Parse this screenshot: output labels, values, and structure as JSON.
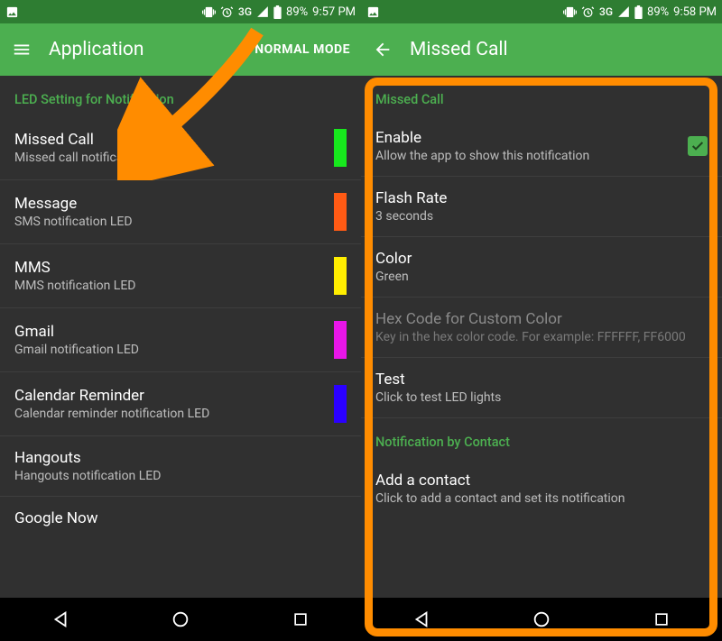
{
  "left": {
    "status": {
      "network": "3G",
      "battery": "89%",
      "time": "9:57 PM"
    },
    "appbar": {
      "title": "Application",
      "mode": "NORMAL MODE"
    },
    "section": "LED Setting for Notification",
    "items": [
      {
        "title": "Missed Call",
        "sub": "Missed call notification LED",
        "swatch": "#17e81d"
      },
      {
        "title": "Message",
        "sub": "SMS notification LED",
        "swatch": "#ff5a14"
      },
      {
        "title": "MMS",
        "sub": "MMS notification LED",
        "swatch": "#ffee00"
      },
      {
        "title": "Gmail",
        "sub": "Gmail notification LED",
        "swatch": "#e816e8"
      },
      {
        "title": "Calendar Reminder",
        "sub": "Calendar reminder notification LED",
        "swatch": "#2a00ff"
      },
      {
        "title": "Hangouts",
        "sub": "Hangouts notification LED",
        "swatch": ""
      },
      {
        "title": "Google Now",
        "sub": "",
        "swatch": ""
      }
    ]
  },
  "right": {
    "status": {
      "network": "3G",
      "battery": "89%",
      "time": "9:58 PM"
    },
    "appbar": {
      "title": "Missed Call"
    },
    "section1": "Missed Call",
    "rows": [
      {
        "title": "Enable",
        "sub": "Allow the app to show this notification",
        "check": true
      },
      {
        "title": "Flash Rate",
        "sub": "3 seconds"
      },
      {
        "title": "Color",
        "sub": "Green"
      },
      {
        "title": "Hex Code for Custom Color",
        "sub": "Key in the hex color code. For example: FFFFFF, FF6000",
        "disabled": true
      },
      {
        "title": "Test",
        "sub": "Click to test LED lights"
      }
    ],
    "section2": "Notification by Contact",
    "rows2": [
      {
        "title": "Add a contact",
        "sub": "Click to add a contact and set its notification"
      }
    ]
  },
  "colors": {
    "accent": "#4caf50",
    "arrow": "#ff8c00"
  }
}
